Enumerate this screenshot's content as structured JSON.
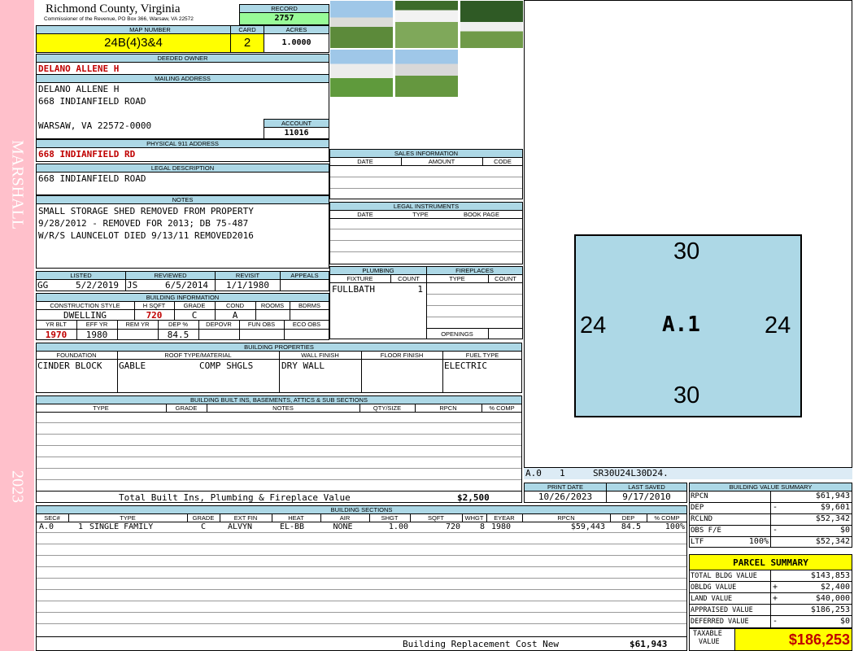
{
  "side": {
    "name": "MARSHALL",
    "year": "2023"
  },
  "header": {
    "county": "Richmond County, Virginia",
    "address_line": "Commissioner of the Revenue, PO Box 366, Warsaw, VA 22572",
    "record_label": "RECORD",
    "record": "2757"
  },
  "map": {
    "map_label": "MAP NUMBER",
    "map_number": "24B(4)3&4",
    "card_label": "CARD",
    "card": "2",
    "acres_label": "ACRES",
    "acres": "1.0000"
  },
  "owner": {
    "label": "DEEDED OWNER",
    "value": "DELANO ALLENE H"
  },
  "mailing": {
    "label": "MAILING ADDRESS",
    "line1": "DELANO ALLENE H",
    "line2": "668 INDIANFIELD ROAD",
    "line3": "WARSAW, VA 22572-0000",
    "account_label": "ACCOUNT",
    "account": "11016"
  },
  "physical": {
    "label": "PHYSICAL 911 ADDRESS",
    "value": "668 INDIANFIELD RD"
  },
  "legal": {
    "label": "LEGAL DESCRIPTION",
    "value": "668 INDIANFIELD ROAD"
  },
  "notes": {
    "label": "NOTES",
    "line1": "SMALL STORAGE SHED REMOVED FROM PROPERTY",
    "line2": "9/28/2012 - REMOVED FOR 2013; DB 75-487",
    "line3": "W/R/S LAUNCELOT DIED 9/13/11 REMOVED2016"
  },
  "dates": {
    "listed_label": "LISTED",
    "reviewed_label": "REVIEWED",
    "revisit_label": "REVISIT",
    "appeals_label": "APPEALS",
    "listed_by": "GG",
    "listed": "5/2/2019",
    "reviewed_by": "JS",
    "reviewed": "6/5/2014",
    "revisit": "1/1/1980",
    "appeals": ""
  },
  "building_info": {
    "label": "BUILDING INFORMATION",
    "h_style": "CONSTRUCTION STYLE",
    "h_sqft": "H SQFT",
    "h_grade": "GRADE",
    "h_cond": "COND",
    "h_rooms": "ROOMS",
    "h_bdrms": "BDRMS",
    "style": "DWELLING",
    "sqft": "720",
    "grade": "C",
    "cond": "A",
    "rooms": "",
    "bdrms": "",
    "h_yrblt": "YR BLT",
    "h_effyr": "EFF YR",
    "h_remyr": "REM YR",
    "h_dep": "DEP %",
    "h_depovr": "DEPOVR",
    "h_funobs": "FUN OBS",
    "h_ecoobs": "ECO OBS",
    "yrblt": "1970",
    "effyr": "1980",
    "remyr": "",
    "dep": "84.5",
    "depovr": "",
    "funobs": "",
    "ecoobs": ""
  },
  "sales": {
    "label": "SALES INFORMATION",
    "date": "DATE",
    "amount": "AMOUNT",
    "code": "CODE"
  },
  "instruments": {
    "label": "LEGAL INSTRUMENTS",
    "date": "DATE",
    "type": "TYPE",
    "bookpage": "BOOK PAGE"
  },
  "plumbing": {
    "label": "PLUMBING",
    "fixture": "FIXTURE",
    "count": "COUNT",
    "row_fixture": "FULLBATH",
    "row_count": "1"
  },
  "fireplaces": {
    "label": "FIREPLACES",
    "type": "TYPE",
    "count": "COUNT",
    "openings": "OPENINGS"
  },
  "properties": {
    "label": "BUILDING PROPERTIES",
    "foundation_label": "FOUNDATION",
    "roof_label": "ROOF TYPE/MATERIAL",
    "wall_label": "WALL FINISH",
    "floor_label": "FLOOR FINISH",
    "fuel_label": "FUEL TYPE",
    "foundation": "CINDER BLOCK",
    "roof_type": "GABLE",
    "roof_material": "COMP SHGLS",
    "wall": "DRY WALL",
    "floor": "",
    "fuel": "ELECTRIC"
  },
  "builtins": {
    "label": "BUILDING BUILT INS, BASEMENTS, ATTICS & SUB SECTIONS",
    "type": "TYPE",
    "grade": "GRADE",
    "notes": "NOTES",
    "qty": "QTY/SIZE",
    "rpcn": "RPCN",
    "pcomp": "% COMP",
    "total_label": "Total Built Ins, Plumbing & Fireplace Value",
    "total": "$2,500"
  },
  "sketch": {
    "top": "30",
    "bottom": "30",
    "left": "24",
    "right": "24",
    "center": "A.1",
    "code_sec": "A.0",
    "code_num": "1",
    "code": "SR30U24L30D24."
  },
  "print": {
    "print_label": "PRINT DATE",
    "saved_label": "LAST SAVED",
    "print_date": "10/26/2023",
    "last_saved": "9/17/2010"
  },
  "sections": {
    "label": "BUILDING SECTIONS",
    "h_sec": "SEC#",
    "h_type": "TYPE",
    "h_grade": "GRADE",
    "h_extfin": "EXT FIN",
    "h_heat": "HEAT",
    "h_air": "AIR",
    "h_shgt": "SHGT",
    "h_sqft": "SQFT",
    "h_whgt": "WHGT",
    "h_eyear": "EYEAR",
    "h_rpcn": "RPCN",
    "h_dep": "DEP",
    "h_pcomp": "% COMP",
    "sec": "A.0",
    "num": "1",
    "type": "SINGLE FAMILY",
    "grade": "C",
    "extfin": "ALVYN",
    "heat": "EL-BB",
    "air": "NONE",
    "shgt": "1.00",
    "sqft": "720",
    "whgt": "8",
    "eyear": "1980",
    "rpcn": "$59,443",
    "dep": "84.5",
    "pcomp": "100%",
    "replacement_label": "Building Replacement Cost New",
    "replacement": "$61,943"
  },
  "value_summary": {
    "label": "BUILDING VALUE SUMMARY",
    "rpcn_label": "RPCN",
    "rpcn": "$61,943",
    "dep_label": "DEP",
    "dep_sign": "-",
    "dep": "$9,601",
    "rclnd_label": "RCLND",
    "rclnd": "$52,342",
    "obs_label": "OBS F/E",
    "obs_sign": "-",
    "obs": "$0",
    "ltf_label": "LTF",
    "ltf_pct": "100%",
    "ltf": "$52,342"
  },
  "parcel": {
    "label": "PARCEL SUMMARY",
    "total_bldg_label": "TOTAL BLDG VALUE",
    "total_bldg": "$143,853",
    "obldg_label": "OBLDG VALUE",
    "obldg_sign": "+",
    "obldg": "$2,400",
    "land_label": "LAND VALUE",
    "land_sign": "+",
    "land": "$40,000",
    "appraised_label": "APPRAISED VALUE",
    "appraised": "$186,253",
    "deferred_label": "DEFERRED VALUE",
    "deferred_sign": "-",
    "deferred": "$0",
    "taxable_label1": "TAXABLE",
    "taxable_label2": "VALUE",
    "taxable": "$186,253"
  },
  "colors": {
    "header_blue": "#add8e6",
    "highlight_yellow": "#ffff00",
    "record_green": "#98fb98",
    "side_pink": "#ffc0cb",
    "value_red": "#c00000"
  }
}
